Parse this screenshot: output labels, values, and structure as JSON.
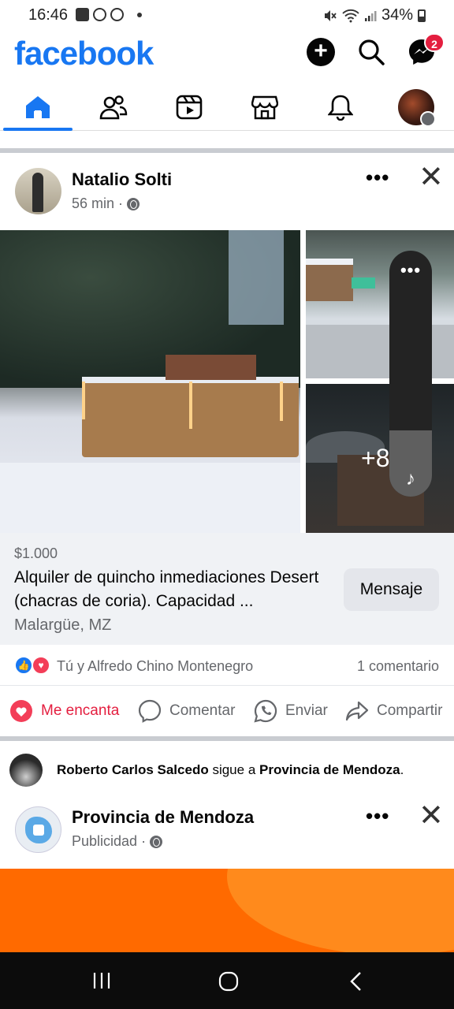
{
  "status_bar": {
    "time": "16:46",
    "battery": "34%"
  },
  "header": {
    "logo": "facebook",
    "messenger_badge": "2"
  },
  "nav": {
    "tabs": [
      {
        "icon": "home-icon",
        "active": true
      },
      {
        "icon": "friends-icon",
        "active": false
      },
      {
        "icon": "video-icon",
        "active": false
      },
      {
        "icon": "marketplace-icon",
        "active": false
      },
      {
        "icon": "bell-icon",
        "active": false
      },
      {
        "icon": "profile-avatar",
        "active": false
      }
    ]
  },
  "post": {
    "author": "Natalio Solti",
    "time": "56 min",
    "dot": "·",
    "more_count": "+8",
    "listing": {
      "price": "$1.000",
      "title": "Alquiler de quincho inmediaciones Desert (chacras de coria). Capacidad ...",
      "location": "Malargüe, MZ",
      "message_button": "Mensaje"
    },
    "reactions": {
      "reacted_by": "Tú y Alfredo Chino Montenegro",
      "comments": "1 comentario"
    },
    "actions": {
      "love": "Me encanta",
      "comment": "Comentar",
      "send": "Enviar",
      "share": "Compartir"
    }
  },
  "follow_notice": {
    "actor": "Roberto Carlos Salcedo",
    "verb": "sigue a",
    "target": "Provincia de Mendoza",
    "end": "."
  },
  "ad": {
    "page": "Provincia de Mendoza",
    "label": "Publicidad",
    "dot": "·"
  },
  "colors": {
    "brand": "#1877f2",
    "love": "#e41e3f",
    "ad_banner": "#ff6a00"
  }
}
